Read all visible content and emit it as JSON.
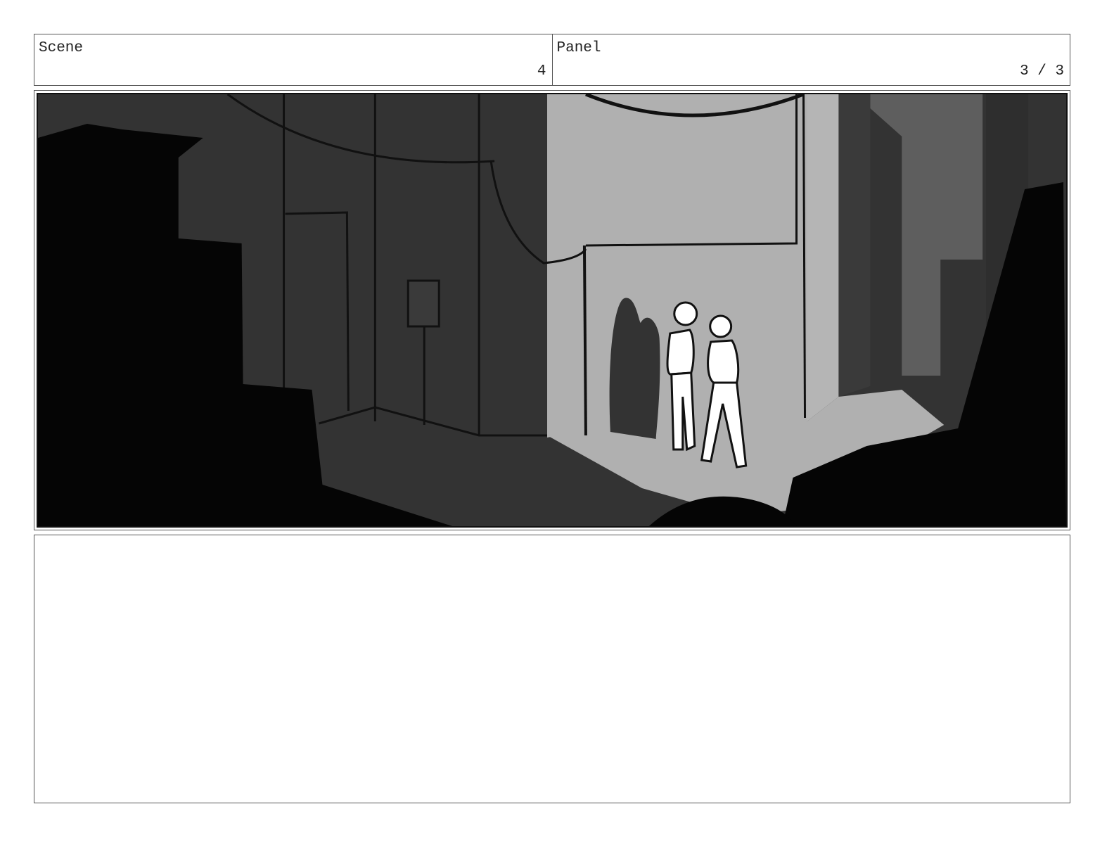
{
  "header": {
    "scene": {
      "label": "Scene",
      "value": "4"
    },
    "panel": {
      "label": "Panel",
      "value": "3 / 3"
    }
  },
  "artwork": {
    "palette": {
      "black": "#050505",
      "dark": "#333333",
      "mid": "#5e5e5e",
      "light": "#b0b0b0",
      "white": "#ffffff"
    }
  },
  "notes": {
    "text": ""
  }
}
